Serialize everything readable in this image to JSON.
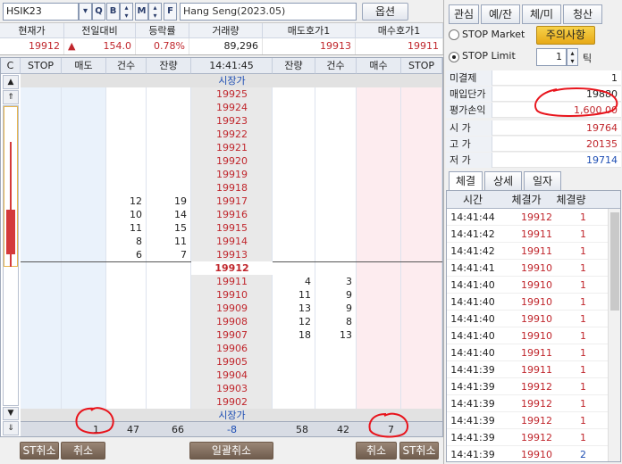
{
  "toolbar": {
    "symbol": "HSIK23",
    "btn_search": "Q",
    "btn_b": "B",
    "btn_m": "M",
    "btn_f": "F",
    "instrument": "Hang Seng(2023.05)",
    "options_label": "옵션"
  },
  "quote": {
    "headers": [
      "현재가",
      "전일대비",
      "등락률",
      "거래량",
      "매도호가1",
      "매수호가1"
    ],
    "current": "19912",
    "change_arrow": "▲",
    "change": "154.0",
    "rate": "0.78%",
    "volume": "89,296",
    "ask1": "19913",
    "bid1": "19911"
  },
  "grid": {
    "headers": [
      "STOP",
      "매도",
      "건수",
      "잔량",
      "14:41:45",
      "잔량",
      "건수",
      "매수",
      "STOP"
    ],
    "corner": "C",
    "top_label": "시장가",
    "bottom_label": "시장가",
    "prices": [
      "19925",
      "19924",
      "19923",
      "19922",
      "19921",
      "19920",
      "19919",
      "19918",
      "19917",
      "19916",
      "19915",
      "19914",
      "19913",
      "19912",
      "19911",
      "19910",
      "19909",
      "19908",
      "19907",
      "19906",
      "19905",
      "19904",
      "19903",
      "19902"
    ],
    "current_price_index": 13,
    "ask_rows": [
      {
        "price_index": 8,
        "count": "12",
        "qty": "19"
      },
      {
        "price_index": 9,
        "count": "10",
        "qty": "14"
      },
      {
        "price_index": 10,
        "count": "11",
        "qty": "15"
      },
      {
        "price_index": 11,
        "count": "8",
        "qty": "11"
      },
      {
        "price_index": 12,
        "count": "6",
        "qty": "7"
      }
    ],
    "bid_rows": [
      {
        "price_index": 14,
        "qty": "4",
        "count": "3"
      },
      {
        "price_index": 15,
        "qty": "11",
        "count": "9"
      },
      {
        "price_index": 16,
        "qty": "13",
        "count": "9"
      },
      {
        "price_index": 17,
        "qty": "12",
        "count": "8"
      },
      {
        "price_index": 18,
        "qty": "18",
        "count": "13"
      }
    ],
    "totals": {
      "sell": "1",
      "sell_count": "47",
      "sell_qty": "66",
      "diff": "-8",
      "buy_qty": "58",
      "buy_count": "42",
      "buy": "7"
    }
  },
  "bottom_buttons": {
    "st_cancel_left": "ST취소",
    "cancel_left": "취소",
    "cancel_all": "일괄취소",
    "cancel_right": "취소",
    "st_cancel_right": "ST취소"
  },
  "right_panel": {
    "tabs": [
      "관심",
      "예/잔",
      "체/미",
      "청산"
    ],
    "stop_market": "STOP Market",
    "stop_limit": "STOP Limit",
    "caution": "주의사항",
    "tick_value": "1",
    "tick_label": "틱",
    "info": [
      {
        "label": "미결제",
        "value": "1"
      },
      {
        "label": "매입단가",
        "value": "19880"
      },
      {
        "label": "평가손익",
        "value": "1,600.00"
      }
    ],
    "ohl": [
      {
        "label": "시 가",
        "value": "19764"
      },
      {
        "label": "고 가",
        "value": "20135"
      },
      {
        "label": "저 가",
        "value": "19714"
      }
    ],
    "subtabs": [
      "체결",
      "상세",
      "일자"
    ],
    "fill_headers": [
      "시간",
      "체결가",
      "체결량"
    ],
    "fills": [
      {
        "time": "14:41:44",
        "price": "19912",
        "qty": "1"
      },
      {
        "time": "14:41:42",
        "price": "19911",
        "qty": "1"
      },
      {
        "time": "14:41:42",
        "price": "19911",
        "qty": "1"
      },
      {
        "time": "14:41:41",
        "price": "19910",
        "qty": "1"
      },
      {
        "time": "14:41:40",
        "price": "19910",
        "qty": "1"
      },
      {
        "time": "14:41:40",
        "price": "19910",
        "qty": "1"
      },
      {
        "time": "14:41:40",
        "price": "19910",
        "qty": "1"
      },
      {
        "time": "14:41:40",
        "price": "19910",
        "qty": "1"
      },
      {
        "time": "14:41:40",
        "price": "19911",
        "qty": "1"
      },
      {
        "time": "14:41:39",
        "price": "19911",
        "qty": "1"
      },
      {
        "time": "14:41:39",
        "price": "19912",
        "qty": "1"
      },
      {
        "time": "14:41:39",
        "price": "19912",
        "qty": "1"
      },
      {
        "time": "14:41:39",
        "price": "19912",
        "qty": "1"
      },
      {
        "time": "14:41:39",
        "price": "19912",
        "qty": "1"
      },
      {
        "time": "14:41:39",
        "price": "19910",
        "qty": "2"
      }
    ]
  },
  "colors": {
    "up": "#c0262c",
    "down": "#1f4fb4",
    "sell_bg": "#eaf2fb",
    "buy_bg": "#fdecef",
    "price_bg": "#e9e9e9",
    "annotation": "#e8141c"
  }
}
